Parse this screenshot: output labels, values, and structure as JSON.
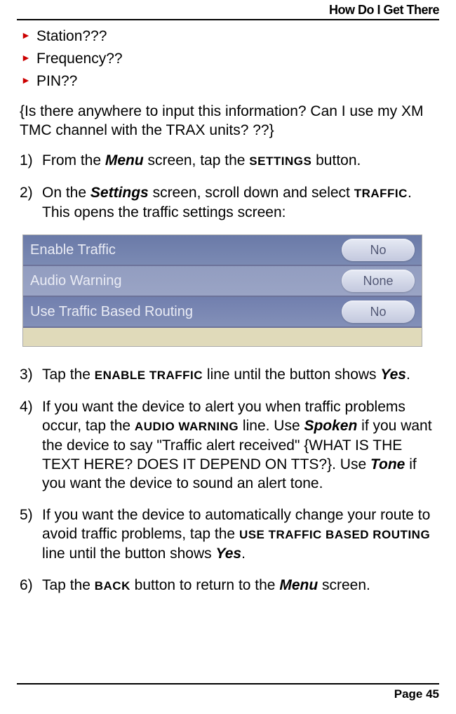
{
  "header": {
    "title": "How Do I Get There"
  },
  "bullets": [
    {
      "text": "Station???"
    },
    {
      "text": "Frequency??"
    },
    {
      "text": "PIN??"
    }
  ],
  "note": "{Is there anywhere to input this information? Can I use my XM TMC channel with the TRAX units? ??}",
  "steps": [
    {
      "num": "1)",
      "pre": "From the ",
      "w1": "Menu",
      "mid1": " screen, tap the ",
      "w2": "SETTINGS",
      "post": " button."
    },
    {
      "num": "2)",
      "pre": "On the ",
      "w1": "Settings",
      "mid1": " screen, scroll down and select ",
      "w2": "TRAFFIC",
      "post": ". This opens the traffic settings screen:"
    },
    {
      "num": "3)",
      "pre": "Tap the ",
      "w1": "ENABLE TRAFFIC",
      "mid1": " line until the button shows ",
      "w2": "Yes",
      "post": "."
    },
    {
      "num": "4)",
      "pre": "If you want the device to alert you when traffic problems occur, tap the ",
      "w1": "AUDIO WARNING",
      "mid1": " line. Use ",
      "w2": "Spoken",
      "mid2": " if you want the device to say \"Traffic alert received\" {WHAT IS THE TEXT HERE? DOES IT DEPEND ON TTS?}. Use ",
      "w3": "Tone",
      "post": " if you want the device to sound an alert tone."
    },
    {
      "num": "5)",
      "pre": "If you want the device to automatically change your route to avoid traffic problems, tap the ",
      "w1": "USE TRAFFIC BASED ROUTING",
      "mid1": " line until the button shows ",
      "w2": "Yes",
      "post": "."
    },
    {
      "num": "6)",
      "pre": "Tap the ",
      "w1": "BACK",
      "mid1": " button to return to the ",
      "w2": "Menu",
      "post": " screen."
    }
  ],
  "screenshot": {
    "rows": [
      {
        "label": "Enable Traffic",
        "value": "No"
      },
      {
        "label": "Audio Warning",
        "value": "None"
      },
      {
        "label": "Use Traffic Based Routing",
        "value": "No"
      }
    ]
  },
  "footer": {
    "text": "Page 45"
  }
}
